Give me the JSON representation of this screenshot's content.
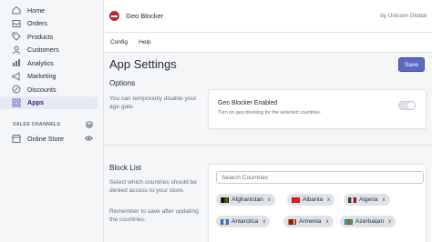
{
  "sidebar": {
    "items": [
      {
        "label": "Home",
        "icon": "home-icon"
      },
      {
        "label": "Orders",
        "icon": "orders-icon"
      },
      {
        "label": "Products",
        "icon": "products-icon"
      },
      {
        "label": "Customers",
        "icon": "customers-icon"
      },
      {
        "label": "Analytics",
        "icon": "analytics-icon"
      },
      {
        "label": "Marketing",
        "icon": "marketing-icon"
      },
      {
        "label": "Discounts",
        "icon": "discounts-icon"
      },
      {
        "label": "Apps",
        "icon": "apps-icon",
        "active": true
      }
    ],
    "sales_channels_label": "SALES CHANNELS",
    "online_store_label": "Online Store"
  },
  "header": {
    "app_name": "Geo Blocker",
    "by_text": "by Unicorn Global"
  },
  "tabs": [
    "Config",
    "Help"
  ],
  "page": {
    "title": "App Settings",
    "save_label": "Save"
  },
  "options": {
    "title": "Options",
    "description": "You can temporarily disable your age gate.",
    "toggle_title": "Geo Blocker Enabled",
    "toggle_help": "Turn on geo blocking for the selected countries.",
    "enabled": false
  },
  "block_list": {
    "title": "Block List",
    "description": "Select which countries should be denied access to your store.",
    "note": "Remember to save after updating the countries.",
    "search_placeholder": "Search Countries",
    "countries": [
      {
        "name": "Afghanistan",
        "flag_colors": [
          "#000000",
          "#be0000",
          "#009900"
        ]
      },
      {
        "name": "Albania",
        "flag_colors": [
          "#e41e20",
          "#e41e20",
          "#e41e20"
        ]
      },
      {
        "name": "Algeria",
        "flag_colors": [
          "#006233",
          "#ffffff",
          "#d21034"
        ]
      },
      {
        "name": "Antarctica",
        "flag_colors": [
          "#3a7dce",
          "#ffffff",
          "#3a7dce"
        ]
      },
      {
        "name": "Armenia",
        "flag_colors": [
          "#d90012",
          "#0033a0",
          "#f2a800"
        ]
      },
      {
        "name": "Azerbaijan",
        "flag_colors": [
          "#00b5e2",
          "#ef3340",
          "#509e2f"
        ]
      }
    ],
    "remove_glyph": "x"
  },
  "colors": {
    "accent": "#5c6ac4",
    "logo": "#c0262f",
    "sidebar_bg": "#f4f6f8"
  }
}
